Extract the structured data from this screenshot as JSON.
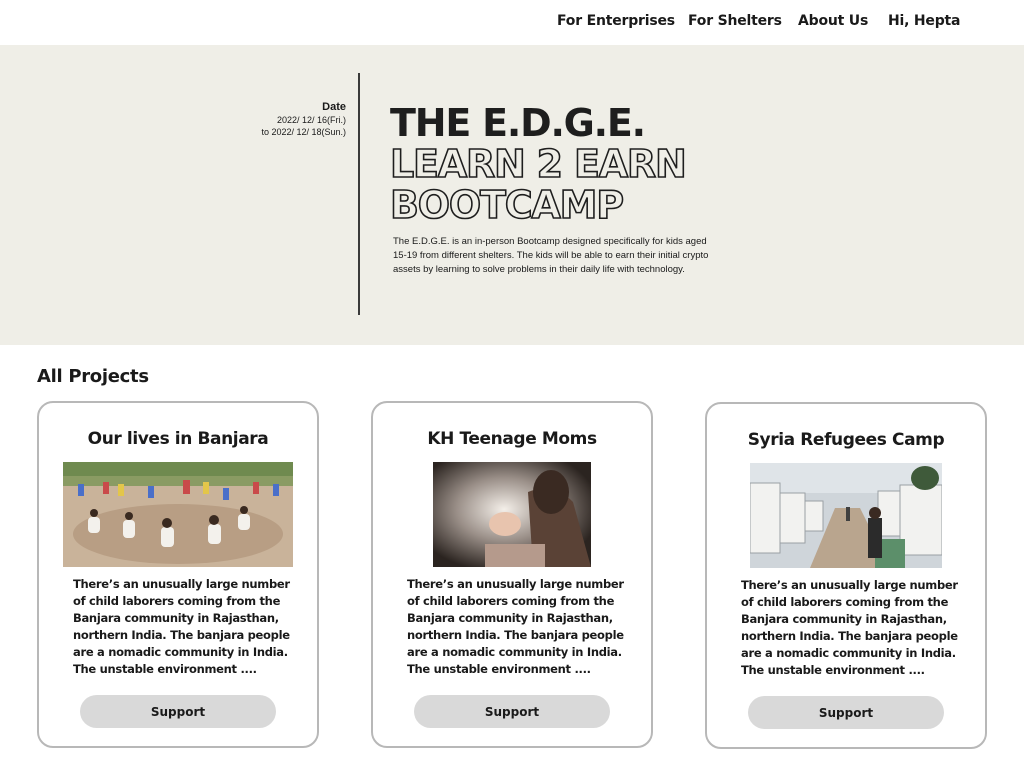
{
  "nav": {
    "items": [
      {
        "label": "For Enterprises"
      },
      {
        "label": "For Shelters"
      },
      {
        "label": "About Us"
      },
      {
        "label": "Hi, Hepta"
      }
    ]
  },
  "hero": {
    "date_label": "Date",
    "date_start": "2022/ 12/ 16(Fri.)",
    "date_end": "to 2022/ 12/ 18(Sun.)",
    "title_line1": "THE E.D.G.E.",
    "title_line2": "LEARN 2 EARN",
    "title_line3": "BOOTCAMP",
    "description": "The E.D.G.E. is an in-person Bootcamp designed specifically for kids aged 15-19 from different shelters. The kids will be able to earn their initial crypto assets by learning to solve problems in their daily life with technology."
  },
  "projects": {
    "section_title": "All Projects",
    "cards": [
      {
        "title": "Our lives in Banjara",
        "description": "There’s an unusually large number of  child laborers coming from the Banjara community in Rajasthan, northern India. The banjara people are a nomadic community in India. The unstable environment  ....",
        "button_label": "Support"
      },
      {
        "title": "KH Teenage Moms",
        "description": "There’s an unusually large number of  child laborers coming from the Banjara community in Rajasthan, northern India. The banjara people are a nomadic community in India. The unstable environment  ....",
        "button_label": "Support"
      },
      {
        "title": "Syria Refugees Camp",
        "description": "There’s an unusually large number of  child laborers coming from the Banjara community in Rajasthan, northern India. The banjara people are a nomadic community in India. The unstable environment  ....",
        "button_label": "Support"
      }
    ]
  },
  "colors": {
    "hero_bg": "#efeee7",
    "button_bg": "#d9d9d9",
    "card_border": "#b8b8b8",
    "text": "#1a1a1a"
  }
}
